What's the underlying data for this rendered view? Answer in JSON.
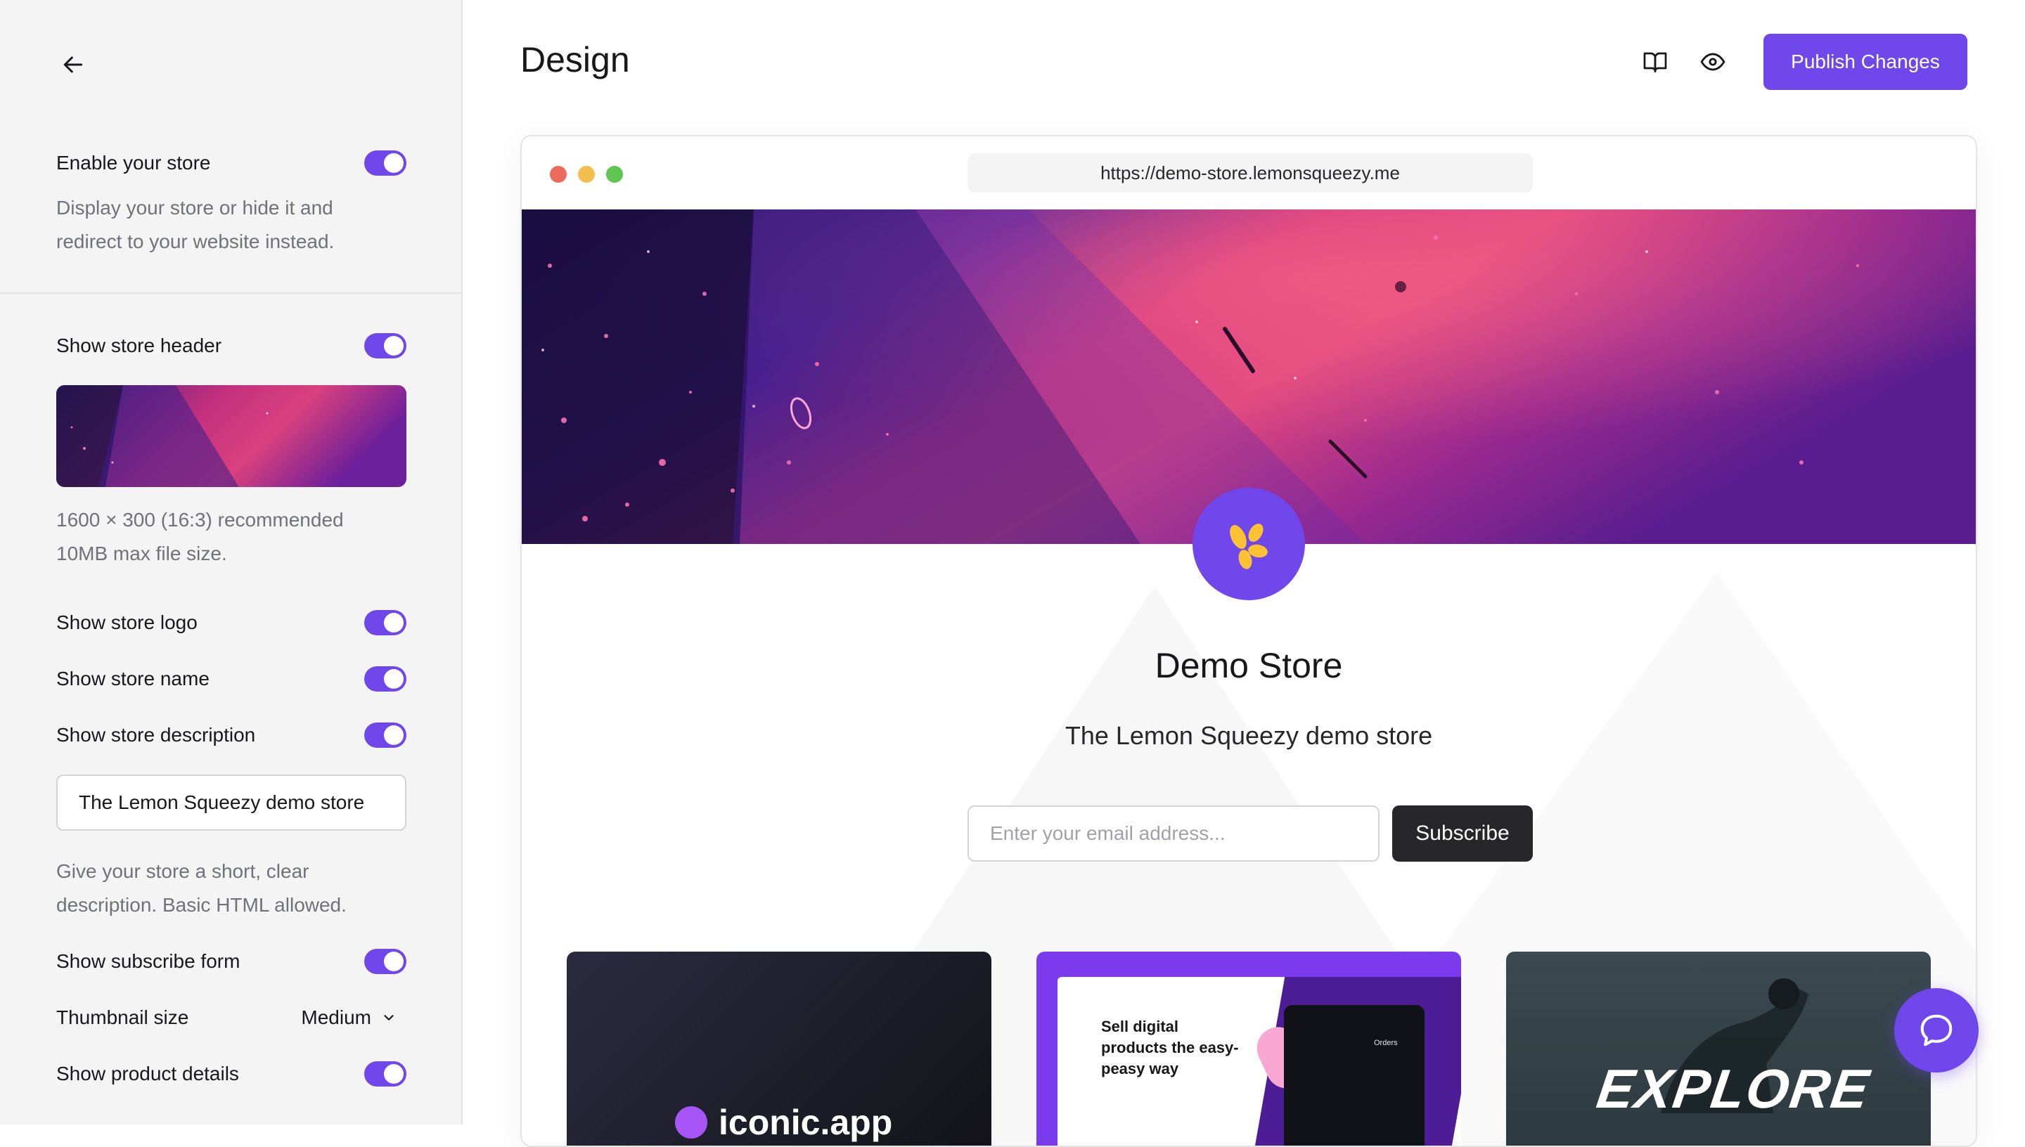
{
  "sidebar": {
    "enable_store": {
      "label": "Enable your store",
      "on": true,
      "help_line1": "Display your store or hide it and",
      "help_line2": "redirect to your website instead."
    },
    "show_header": {
      "label": "Show store header",
      "on": true
    },
    "header_hint_line1": "1600 × 300 (16:3) recommended",
    "header_hint_line2": "10MB max file size.",
    "show_logo": {
      "label": "Show store logo",
      "on": true
    },
    "show_name": {
      "label": "Show store name",
      "on": true
    },
    "show_description": {
      "label": "Show store description",
      "on": true
    },
    "description_value": "The Lemon Squeezy demo store",
    "description_help_line1": "Give your store a short, clear",
    "description_help_line2": "description. Basic HTML allowed.",
    "show_subscribe": {
      "label": "Show subscribe form",
      "on": true
    },
    "thumbnail": {
      "label": "Thumbnail size",
      "value": "Medium"
    },
    "show_details": {
      "label": "Show product details",
      "on": true
    }
  },
  "header": {
    "title": "Design",
    "publish_label": "Publish Changes"
  },
  "preview": {
    "url": "https://demo-store.lemonsqueezy.me",
    "store_name": "Demo Store",
    "store_description": "The Lemon Squeezy demo store",
    "email_placeholder": "Enter your email address...",
    "subscribe_label": "Subscribe",
    "products": [
      {
        "text": "iconic.app"
      },
      {
        "text": "Sell digital products the easy-peasy way",
        "badge": "Orders"
      },
      {
        "text": "EXPLORE"
      }
    ]
  },
  "colors": {
    "accent": "#7047eb",
    "dark_button": "#27272a",
    "traffic_red": "#ec6a5e",
    "traffic_yellow": "#f4be4f",
    "traffic_green": "#61c554"
  },
  "icons": [
    "arrow-left-icon",
    "book-open-icon",
    "eye-icon",
    "lemon-logo-icon",
    "chevron-down-icon",
    "chat-icon"
  ]
}
